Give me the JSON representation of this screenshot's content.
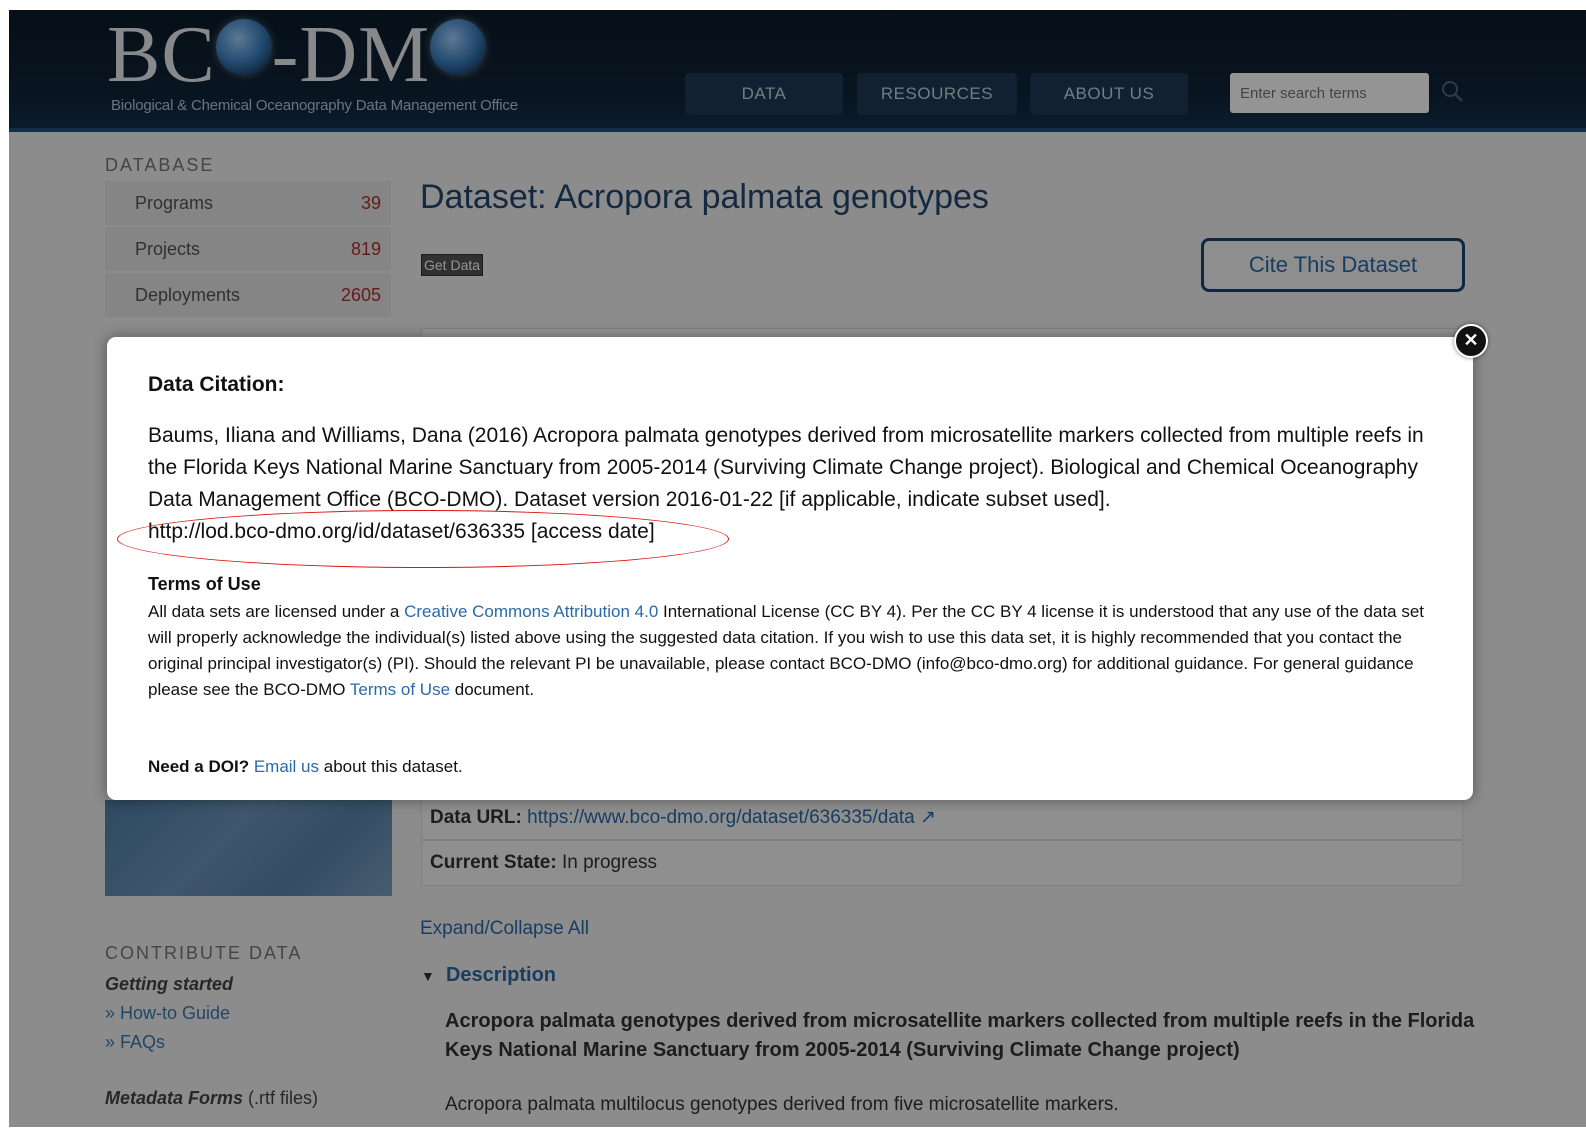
{
  "header": {
    "logo_text_a": "BC",
    "logo_text_b": "-DM",
    "logo_subtitle": "Biological & Chemical Oceanography Data Management Office",
    "nav": [
      "DATA",
      "RESOURCES",
      "ABOUT US"
    ],
    "search_placeholder": "Enter search terms"
  },
  "sidebar": {
    "database_heading": "DATABASE",
    "items": [
      {
        "label": "Programs",
        "count": "39"
      },
      {
        "label": "Projects",
        "count": "819"
      },
      {
        "label": "Deployments",
        "count": "2605"
      }
    ],
    "contribute_heading": "CONTRIBUTE DATA",
    "getting_started": "Getting started",
    "links": [
      "» How-to Guide",
      "» FAQs"
    ],
    "metadata_forms": "Metadata Forms",
    "metadata_forms_note": " (.rtf files)"
  },
  "main": {
    "title": "Dataset: Acropora palmata genotypes",
    "get_data": "Get Data",
    "cite_button": "Cite This Dataset",
    "data_url_label": "Data URL:",
    "data_url": "https://www.bco-dmo.org/dataset/636335/data",
    "state_label": "Current State:",
    "state_value": "In progress",
    "expand_all": "Expand/Collapse All",
    "description_heading": "Description",
    "description_title": "Acropora palmata genotypes derived from microsatellite markers collected from multiple reefs in the Florida Keys National Marine Sanctuary from 2005-2014 (Surviving Climate Change project)",
    "description_text": "Acropora palmata multilocus genotypes derived from five microsatellite markers."
  },
  "modal": {
    "heading": "Data Citation:",
    "citation": "Baums, Iliana and Williams, Dana (2016) Acropora palmata genotypes derived from microsatellite markers collected from multiple reefs in the Florida Keys National Marine Sanctuary from 2005-2014 (Surviving Climate Change project). Biological and Chemical Oceanography Data Management Office (BCO-DMO). Dataset version 2016-01-22 [if applicable, indicate subset used].",
    "citation_url": "http://lod.bco-dmo.org/id/dataset/636335 [access date]",
    "terms_heading": "Terms of Use",
    "terms_1": "All data sets are licensed under a ",
    "terms_link": "Creative Commons Attribution 4.0",
    "terms_2": " International License (CC BY 4). Per the CC BY 4 license it is understood that any use of the data set will properly acknowledge the individual(s) listed above using the suggested data citation. If you wish to use this data set, it is highly recommended that you contact the original principal investigator(s) (PI). Should the relevant PI be unavailable, please contact BCO-DMO (info@bco-dmo.org) for additional guidance. For general guidance please see the BCO-DMO ",
    "terms_link2": "Terms of Use",
    "terms_3": " document.",
    "doi_bold": "Need a DOI?",
    "doi_link": "Email us",
    "doi_rest": " about this dataset."
  },
  "colors": {
    "accent": "#2a6aa8",
    "highlight": "#d11111",
    "header_bg": "#0f2438"
  }
}
